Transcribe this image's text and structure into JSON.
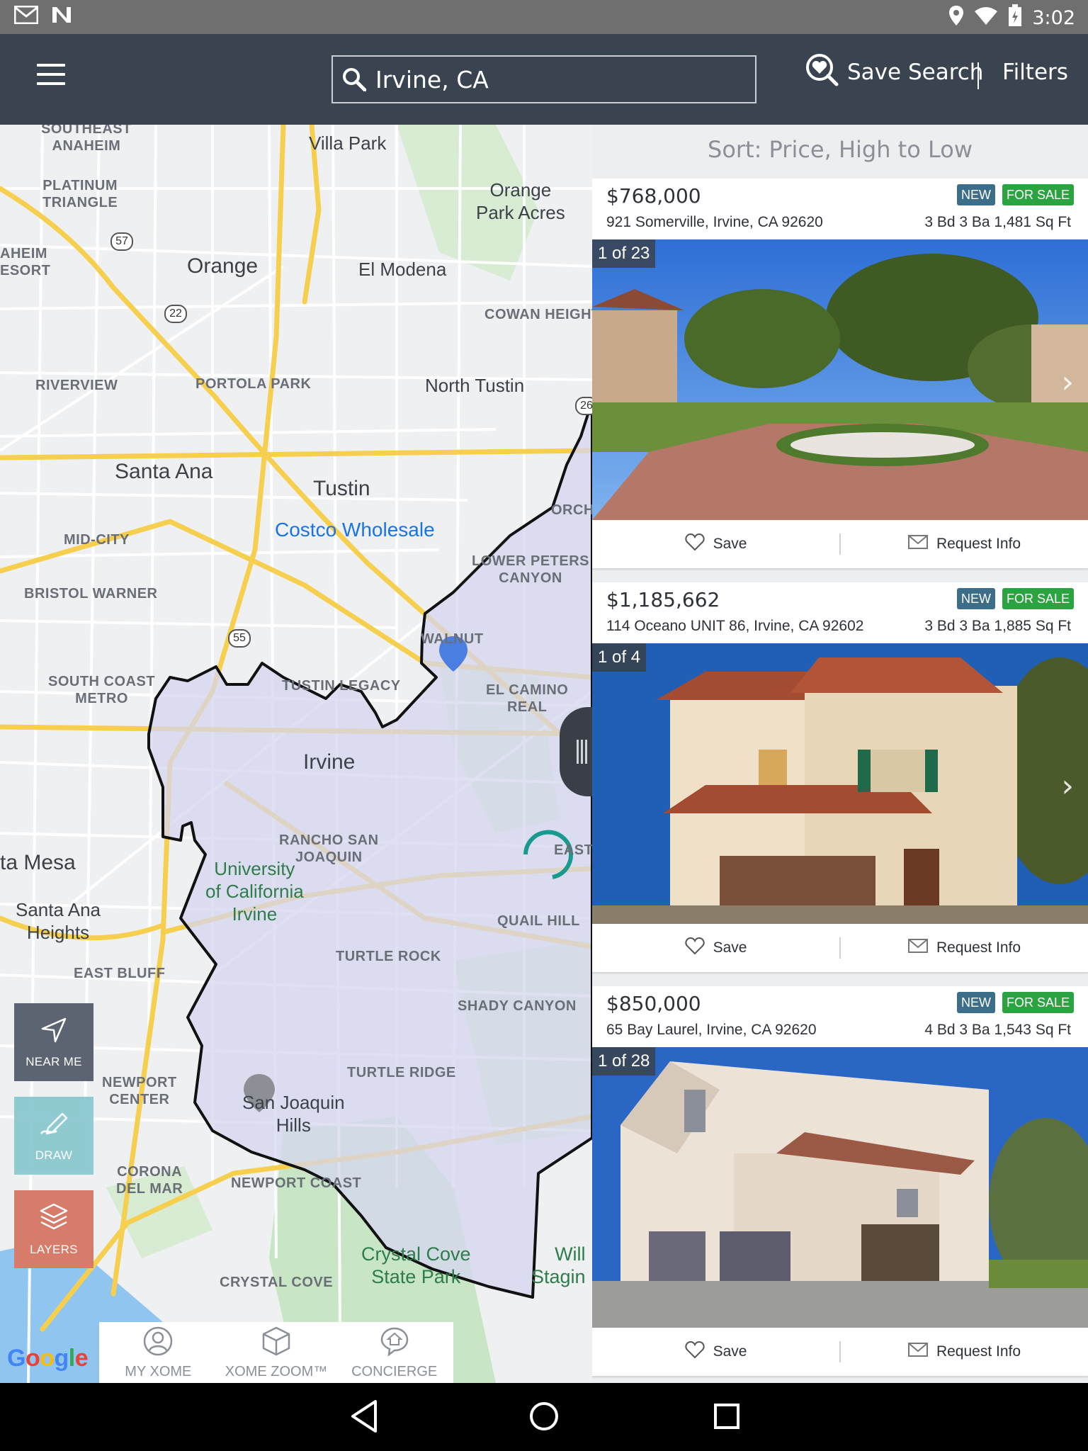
{
  "status_bar": {
    "time": "3:02"
  },
  "header": {
    "search_value": "Irvine, CA",
    "save_search_label": "Save Search",
    "filters_label": "Filters"
  },
  "map": {
    "labels": {
      "southeast_anaheim": "SOUTHEAST\nANAHEIM",
      "villa_park": "Villa Park",
      "platinum_triangle": "PLATINUM\nTRIANGLE",
      "orange_park_acres": "Orange\nPark Acres",
      "anaheim_resort": "AHEIM\nESORT",
      "orange": "Orange",
      "el_modena": "El Modena",
      "cowan_heights": "COWAN HEIGHTS",
      "riverview": "RIVERVIEW",
      "portola_park": "PORTOLA PARK",
      "north_tustin": "North Tustin",
      "santa_ana": "Santa Ana",
      "tustin": "Tustin",
      "orchard": "ORCHA",
      "costco": "Costco Wholesale",
      "mid_city": "MID-CITY",
      "lower_peters_canyon": "LOWER PETERS\nCANYON",
      "bristol_warner": "BRISTOL WARNER",
      "walnut": "WALNUT",
      "south_coast_metro": "SOUTH COAST\nMETRO",
      "tustin_legacy": "TUSTIN LEGACY",
      "el_camino_real": "EL CAMINO\nREAL",
      "irvine": "Irvine",
      "rancho_san_joaquin": "RANCHO SAN\nJOAQUIN",
      "east": "EAST",
      "costa_mesa": "ta Mesa",
      "uci": "University\nof California\nIrvine",
      "santa_ana_heights": "Santa Ana\nHeights",
      "quail_hill": "QUAIL HILL",
      "turtle_rock": "TURTLE ROCK",
      "east_bluff": "EAST BLUFF",
      "shady_canyon": "SHADY CANYON",
      "newport_center": "NEWPORT\nCENTER",
      "turtle_ridge": "TURTLE RIDGE",
      "san_joaquin_hills": "San Joaquin\nHills",
      "corona_del_mar": "CORONA\nDEL MAR",
      "newport_coast": "NEWPORT COAST",
      "crystal_cove_state_park": "Crystal Cove\nState Park",
      "will_staging": "Will\nStagin",
      "crystal_cove": "CRYSTAL COVE"
    },
    "shields": [
      "57",
      "22",
      "55",
      "26"
    ],
    "fabs": {
      "near_me": "NEAR ME",
      "draw": "DRAW",
      "layers": "LAYERS"
    },
    "bottom_nav": [
      "MY XOME",
      "XOME ZOOM™",
      "CONCIERGE"
    ],
    "google": "Google"
  },
  "listings": {
    "sort_label": "Sort: Price, High to Low",
    "save_label": "Save",
    "request_label": "Request Info",
    "new_badge": "NEW",
    "sale_badge": "FOR SALE",
    "items": [
      {
        "price": "$768,000",
        "address": "921 Somerville, Irvine, CA 92620",
        "stats": "3 Bd  3 Ba  1,481 Sq Ft",
        "photo_count": "1 of 23"
      },
      {
        "price": "$1,185,662",
        "address": "114 Oceano UNIT 86, Irvine, CA 92602",
        "stats": "3 Bd  3 Ba  1,885 Sq Ft",
        "photo_count": "1 of 4"
      },
      {
        "price": "$850,000",
        "address": "65 Bay Laurel, Irvine, CA 92620",
        "stats": "4 Bd  3 Ba  1,543 Sq Ft",
        "photo_count": "1 of 28"
      }
    ]
  },
  "colors": {
    "appbar": "#3a4350",
    "boundary_fill": "#d6d5ef",
    "badge_new": "#3c6e8a",
    "badge_sale": "#2ba340",
    "layers_fab": "#d77b6a",
    "draw_fab": "#8cc8d0"
  }
}
